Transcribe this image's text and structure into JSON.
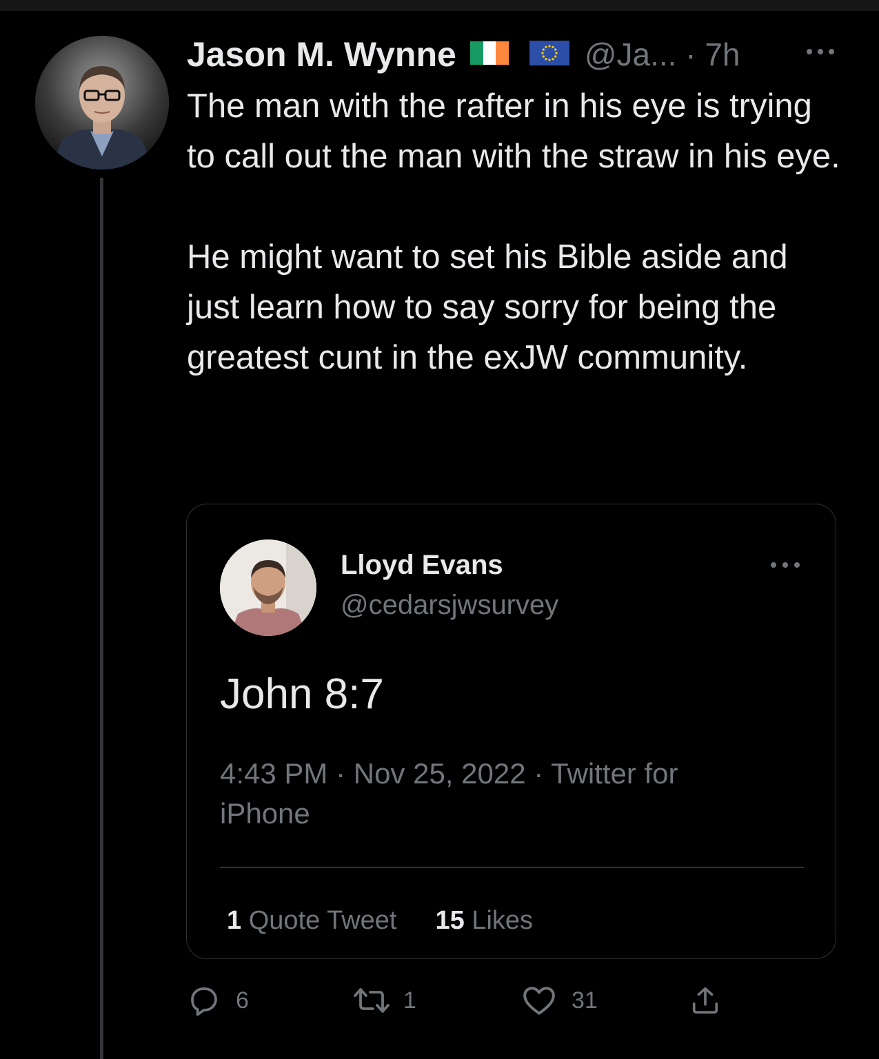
{
  "tweet": {
    "author": {
      "display_name": "Jason M. Wynne",
      "flags": [
        "ireland-flag",
        "eu-flag"
      ],
      "handle": "@Ja...",
      "separator": "·",
      "time": "7h"
    },
    "more_icon": "more-horizontal-icon",
    "text_paragraphs": [
      "The man with the rafter in his eye is trying to call out the man with the straw in his eye.",
      "He might want to set his Bible aside and just learn how to say sorry for being the greatest cunt in the exJW community."
    ],
    "quoted": {
      "display_name": "Lloyd Evans",
      "handle": "@cedarsjwsurvey",
      "text": "John 8:7",
      "meta": "4:43 PM · Nov 25, 2022 · Twitter for iPhone",
      "quote_tweets_count": "1",
      "quote_tweets_label": "Quote Tweet",
      "likes_count": "15",
      "likes_label": "Likes"
    },
    "actions": {
      "replies": {
        "icon": "reply-icon",
        "count": "6"
      },
      "retweets": {
        "icon": "retweet-icon",
        "count": "1"
      },
      "likes": {
        "icon": "heart-icon",
        "count": "31"
      },
      "share": {
        "icon": "share-icon"
      }
    }
  },
  "colors": {
    "background": "#000000",
    "text_primary": "#e7e9ea",
    "text_secondary": "#71767b",
    "border": "#2f3336",
    "thread_line": "#333639"
  }
}
